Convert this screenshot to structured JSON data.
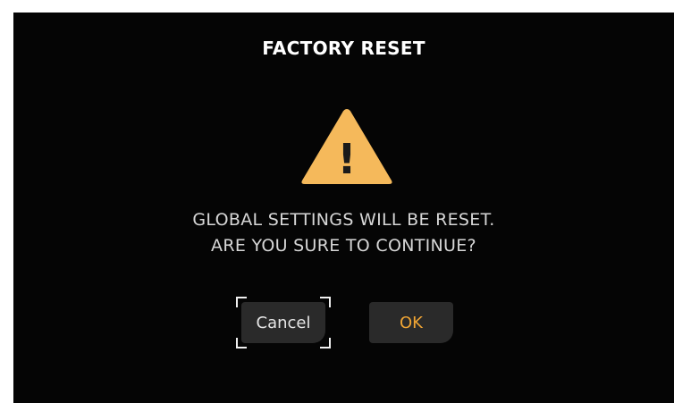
{
  "dialog": {
    "title": "FACTORY RESET",
    "message_line1": "GLOBAL SETTINGS WILL BE RESET.",
    "message_line2": "ARE YOU SURE TO CONTINUE?",
    "icon": "warning-icon",
    "icon_glyph": "!"
  },
  "buttons": {
    "cancel_label": "Cancel",
    "ok_label": "OK",
    "focused": "cancel"
  },
  "colors": {
    "background": "#050505",
    "title": "#ffffff",
    "message": "#d7d7d7",
    "warning": "#f5b95b",
    "button_bg": "#2a2a2a",
    "cancel_text": "#e6e6e6",
    "ok_text": "#f0a534",
    "focus_bracket": "#f0f0f0"
  }
}
